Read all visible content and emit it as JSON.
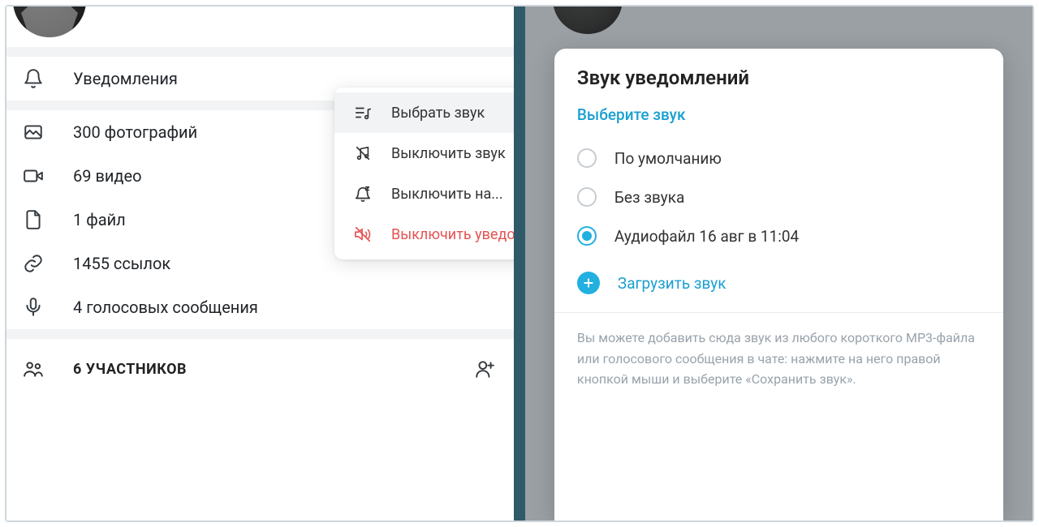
{
  "left": {
    "notifications_label": "Уведомления",
    "media": {
      "photos": "300 фотографий",
      "videos": "69 видео",
      "files": "1 файл",
      "links": "1455 ссылок",
      "voice": "4 голосовых сообщения"
    },
    "members_header": "6 УЧАСТНИКОВ",
    "context_menu": {
      "choose_sound": "Выбрать звук",
      "mute_sound": "Выключить звук",
      "mute_for": "Выключить на...",
      "disable_notifications": "Выключить уведомления"
    }
  },
  "right": {
    "modal_title": "Звук уведомлений",
    "modal_subtitle": "Выберите звук",
    "options": {
      "default": "По умолчанию",
      "silent": "Без звука",
      "custom": "Аудиофайл 16 авг в 11:04"
    },
    "upload_label": "Загрузить звук",
    "hint": "Вы можете добавить сюда звук из любого короткого MP3-файла или голосового сообщения в чате: нажмите на него правой кнопкой мыши и выберите «Сохранить звук»."
  }
}
